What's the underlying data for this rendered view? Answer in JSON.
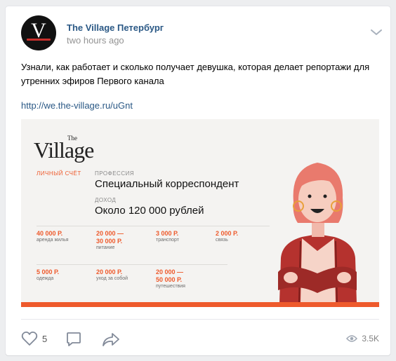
{
  "post": {
    "author": "The Village Петербург",
    "avatar_letter": "V",
    "time": "two hours ago",
    "text": "Узнали, как работает и сколько получает девушка, которая делает репортажи для утренних эфиров Первого канала",
    "link": "http://we.the-village.ru/uGnt"
  },
  "card": {
    "logo_small": "The",
    "logo_big": "Village",
    "section_label": "ЛИЧНЫЙ СЧЁТ",
    "profession_label": "ПРОФЕССИЯ",
    "profession_value": "Специальный корреспондент",
    "income_label": "ДОХОД",
    "income_value": "Около 120 000 рублей",
    "expenses": [
      {
        "amount": "40 000 Р.",
        "note": "аренда жилья"
      },
      {
        "amount": "20 000 —\n30 000 Р.",
        "note": "питание"
      },
      {
        "amount": "3 000 Р.",
        "note": "транспорт"
      },
      {
        "amount": "2 000 Р.",
        "note": "связь"
      },
      {
        "amount": "5 000 Р.",
        "note": "одежда"
      },
      {
        "amount": "20 000 Р.",
        "note": "уход за собой"
      },
      {
        "amount": "20 000 —\n50 000 Р.",
        "note": "путешествия"
      }
    ],
    "accent_color": "#ee5a2c"
  },
  "actions": {
    "likes": "5",
    "views": "3.5K"
  },
  "colors": {
    "link": "#2a5885",
    "muted": "#939393"
  }
}
